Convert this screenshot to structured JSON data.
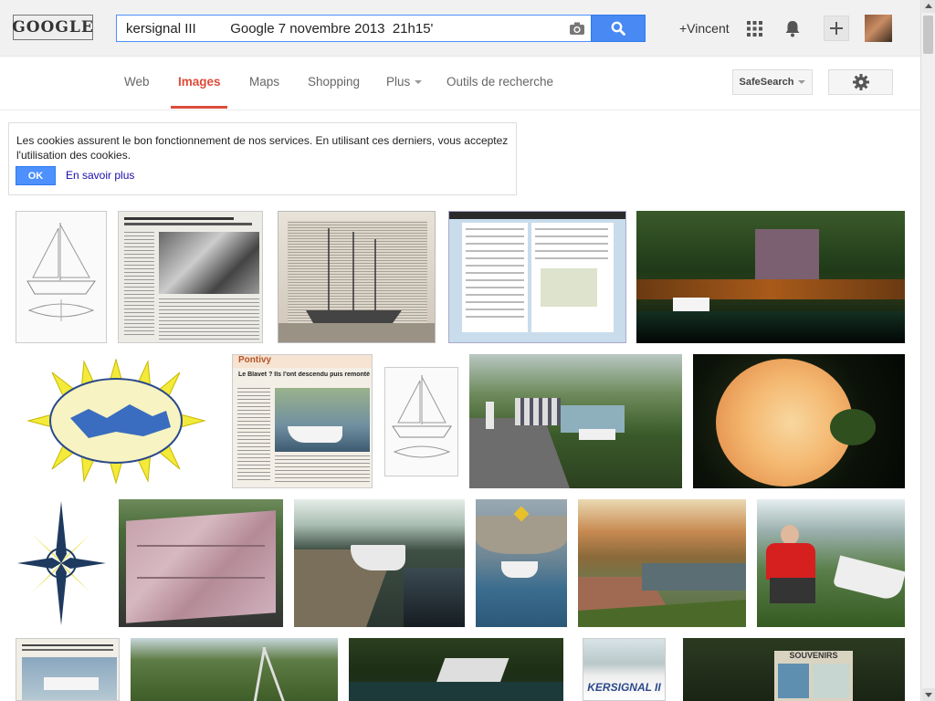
{
  "header": {
    "logo_text": "GOOGLE",
    "search_value": "kersignal III         Google 7 novembre 2013  21h15'",
    "user_link": "+Vincent"
  },
  "nav": {
    "tabs": [
      {
        "label": "Web",
        "active": false
      },
      {
        "label": "Images",
        "active": true
      },
      {
        "label": "Maps",
        "active": false
      },
      {
        "label": "Shopping",
        "active": false
      },
      {
        "label": "Plus",
        "active": false
      },
      {
        "label": "Outils de recherche",
        "active": false
      }
    ],
    "safesearch_label": "SafeSearch"
  },
  "cookie_notice": {
    "text": "Les cookies assurent le bon fonctionnement de nos services. En utilisant ces derniers, vous acceptez l'utilisation des cookies.",
    "ok_label": "OK",
    "learn_more_label": "En savoir plus"
  },
  "thumbnails": {
    "pontivy_label": "Pontivy",
    "pontivy_headline": "Le Blavet ? Ils l'ont descendu puis remonté",
    "kersignal_label": "KERSIGNAL II",
    "souvenirs_label": "SOUVENIRS"
  },
  "colors": {
    "accent_red": "#dd4b39",
    "search_blue": "#4889f4",
    "link_blue": "#1a0dab"
  }
}
